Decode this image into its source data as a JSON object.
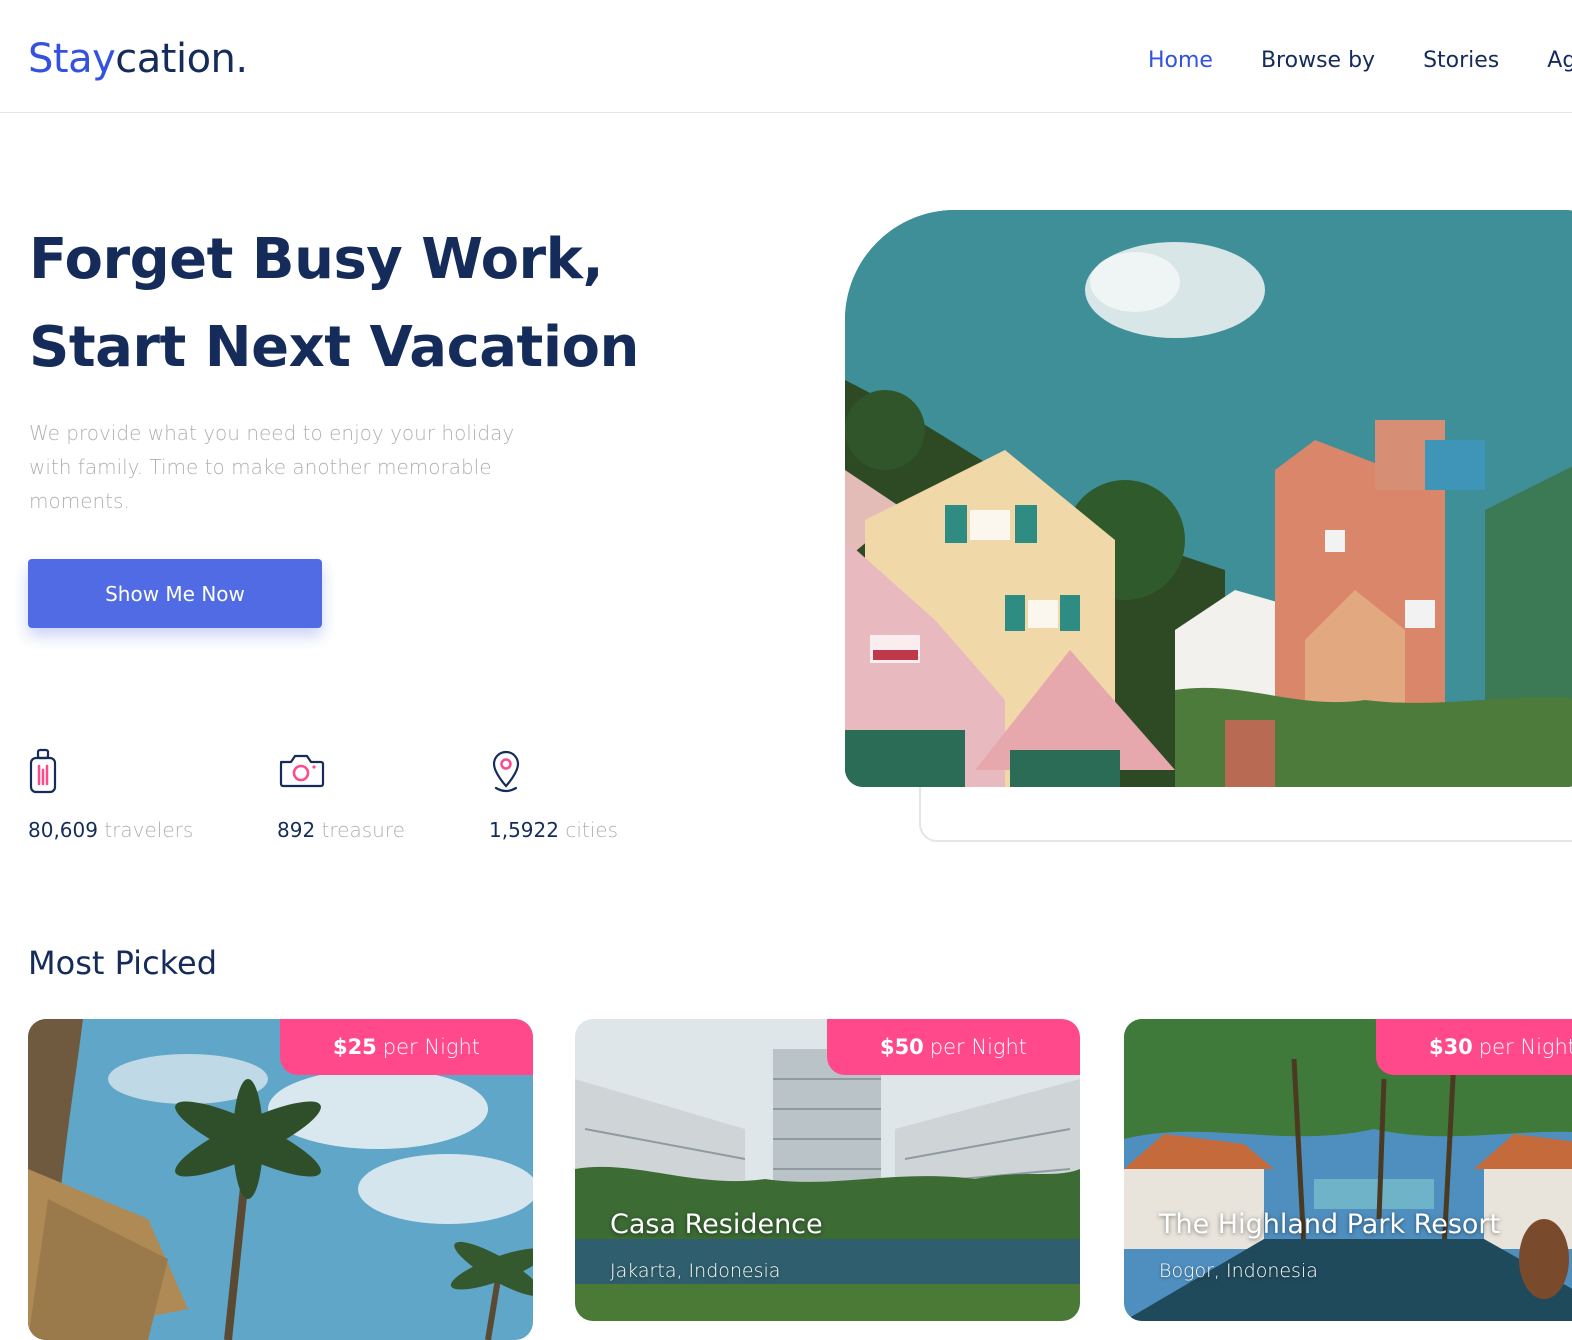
{
  "brand": {
    "accent": "Stay",
    "rest": "cation."
  },
  "nav": {
    "items": [
      "Home",
      "Browse by",
      "Stories",
      "Agents"
    ],
    "active": "Home"
  },
  "hero": {
    "title_line1": "Forget Busy Work,",
    "title_line2": "Start Next Vacation",
    "description": "We provide what you need to enjoy your holiday with family. Time to make another memorable moments.",
    "cta_label": "Show Me Now",
    "image_icon": "house-village-photo"
  },
  "stats": [
    {
      "icon": "suitcase-icon",
      "number": "80,609",
      "label": "travelers"
    },
    {
      "icon": "camera-icon",
      "number": "892",
      "label": "treasure"
    },
    {
      "icon": "location-pin-icon",
      "number": "1,5922",
      "label": "cities"
    }
  ],
  "most_picked": {
    "title": "Most Picked",
    "cards": [
      {
        "price": "$25",
        "unit": "per Night",
        "name": "",
        "location": "",
        "image_icon": "palm-beach-photo"
      },
      {
        "price": "$50",
        "unit": "per Night",
        "name": "Casa Residence",
        "location": "Jakarta, Indonesia",
        "image_icon": "apartment-pool-photo"
      },
      {
        "price": "$30",
        "unit": "per Night",
        "name": "The Highland Park Resort",
        "location": "Bogor, Indonesia",
        "image_icon": "resort-palms-photo"
      }
    ]
  },
  "colors": {
    "primary": "#3252df",
    "navy": "#152c5b",
    "muted": "#b0b0b0",
    "pink": "#ff498b",
    "border": "#e5e5e5"
  }
}
